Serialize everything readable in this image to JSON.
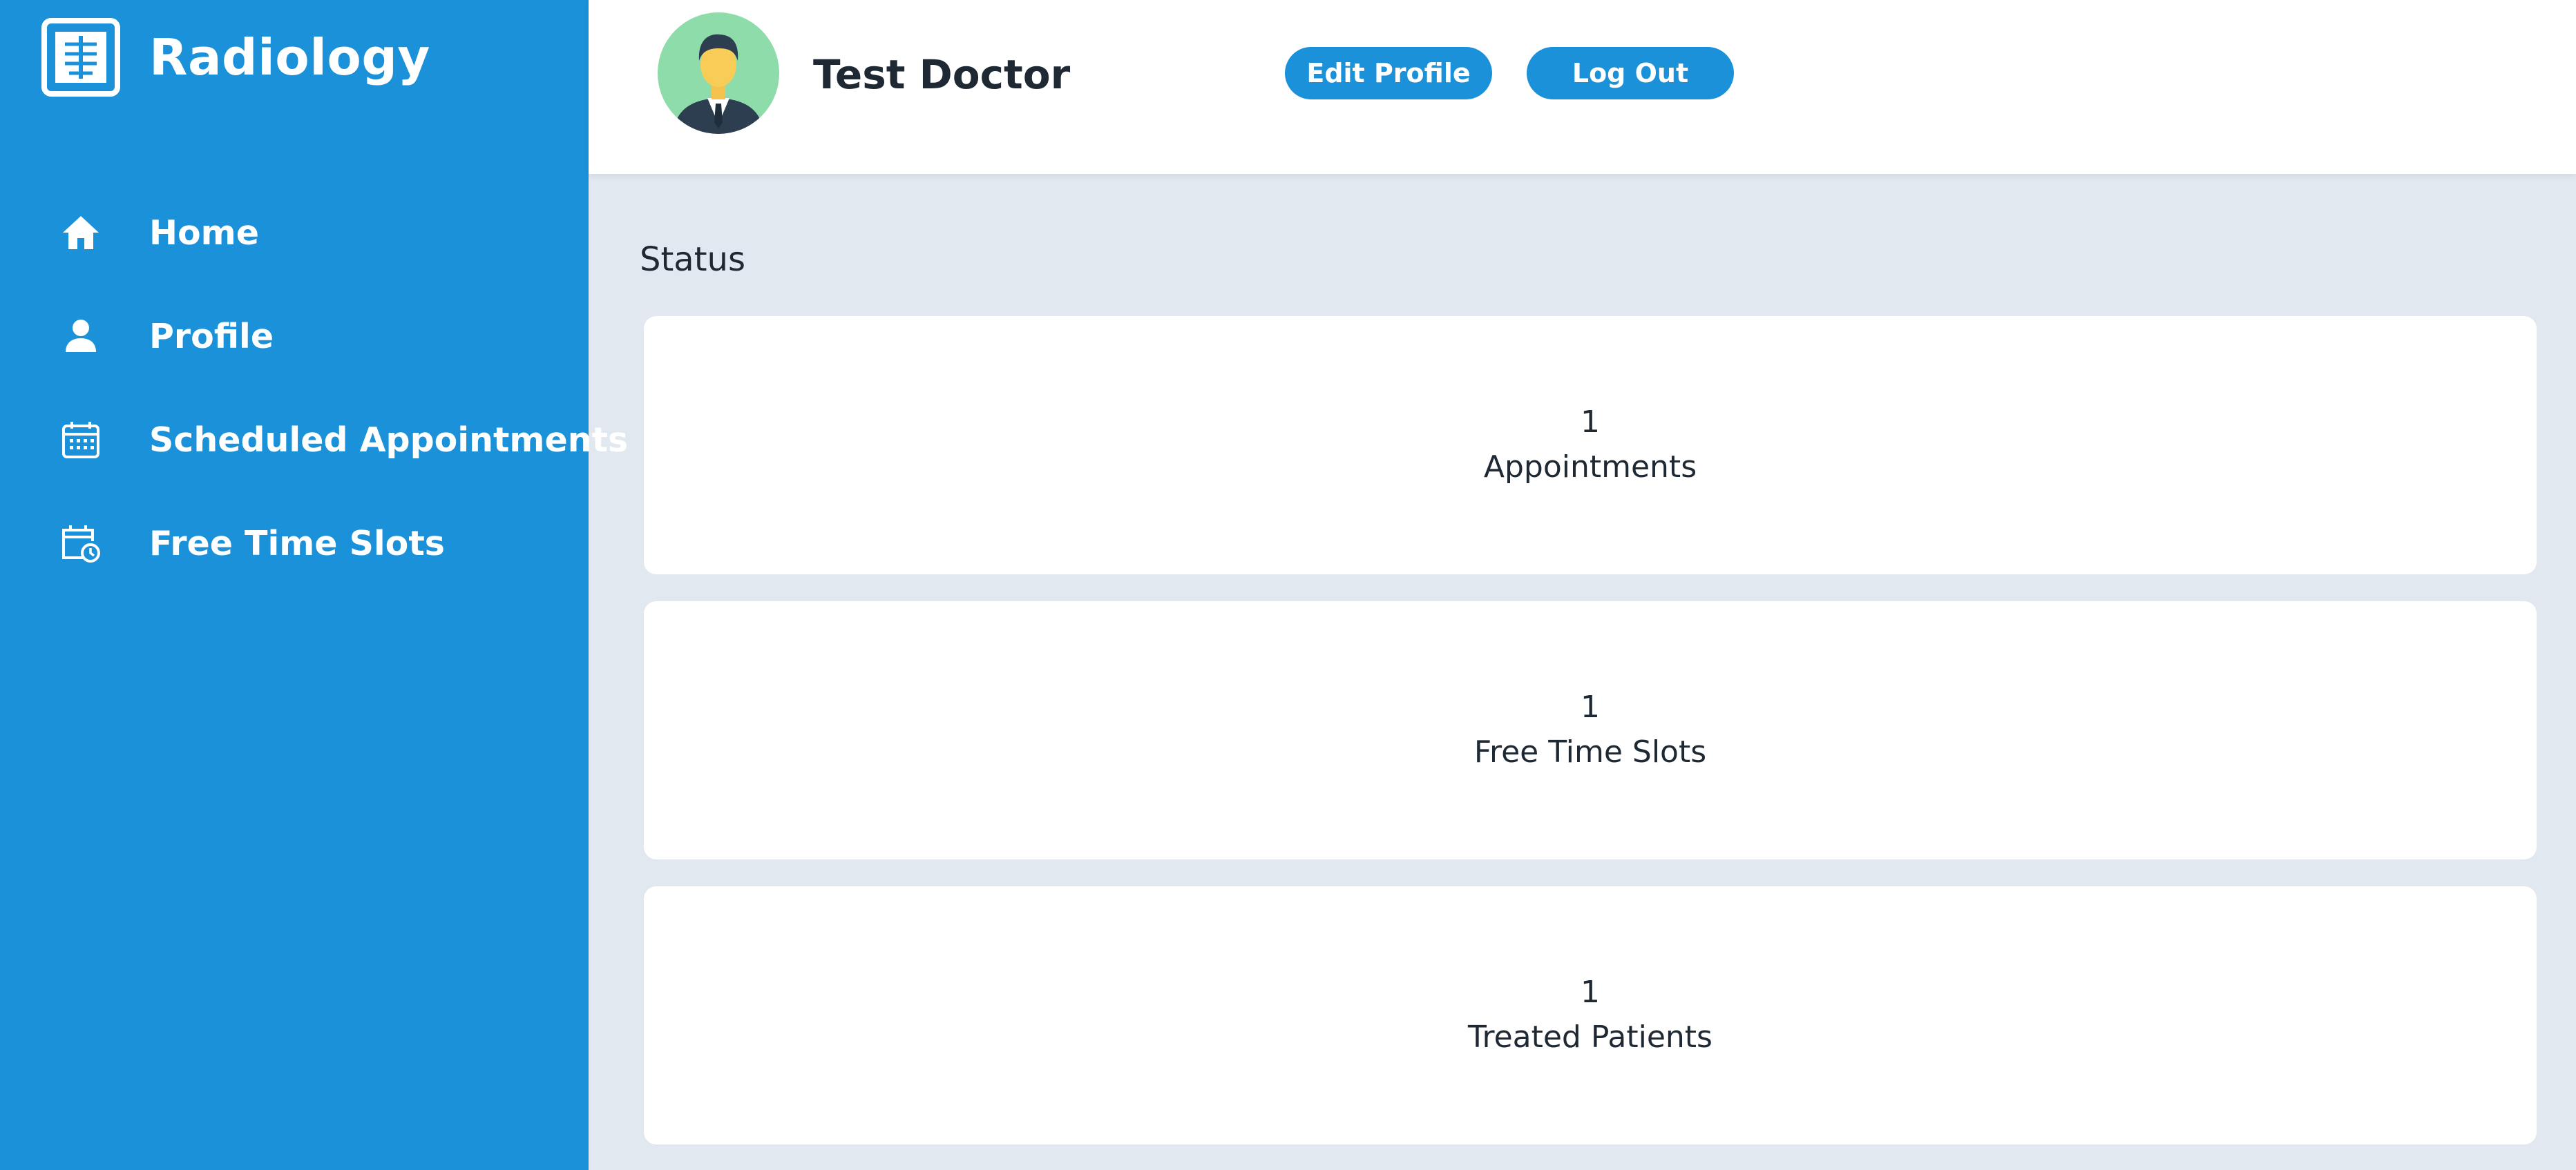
{
  "brand": {
    "name": "Radiology"
  },
  "sidebar": {
    "items": [
      {
        "label": "Home",
        "icon": "home-icon"
      },
      {
        "label": "Profile",
        "icon": "person-icon"
      },
      {
        "label": "Scheduled Appointments",
        "icon": "calendar-icon"
      },
      {
        "label": "Free Time Slots",
        "icon": "calendar-clock-icon"
      }
    ]
  },
  "header": {
    "doctor_name": "Test Doctor",
    "edit_profile_label": "Edit Profile",
    "logout_label": "Log Out"
  },
  "main": {
    "section_title": "Status",
    "cards": [
      {
        "value": "1",
        "label": "Appointments"
      },
      {
        "value": "1",
        "label": "Free Time Slots"
      },
      {
        "value": "1",
        "label": "Treated Patients"
      }
    ]
  },
  "colors": {
    "primary": "#1a91d8",
    "background": "#e2e8f0",
    "card": "#ffffff",
    "text": "#1f2933",
    "avatar_bg": "#8ddcaa"
  }
}
